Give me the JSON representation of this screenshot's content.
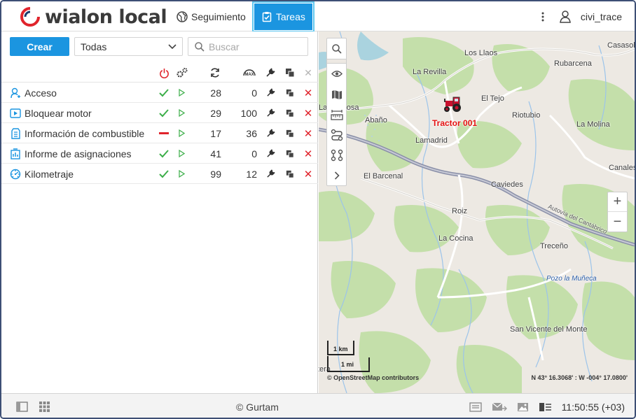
{
  "header": {
    "logo_text": "wialon local",
    "nav": [
      {
        "label": "Seguimiento",
        "icon": "globe-icon"
      },
      {
        "label": "Tareas",
        "icon": "clipboard-check-icon"
      }
    ],
    "user_name": "civi_trace"
  },
  "toolbar": {
    "create_label": "Crear",
    "filter_value": "Todas",
    "search_placeholder": "Buscar"
  },
  "table": {
    "columns": [
      "state",
      "run-settings",
      "count",
      "max",
      "edit",
      "copy",
      "delete"
    ],
    "rows": [
      {
        "icon": "user-key-icon",
        "name": "Acceso",
        "state": "enabled",
        "count": "28",
        "max": "0"
      },
      {
        "icon": "play-square-icon",
        "name": "Bloquear motor",
        "state": "enabled",
        "count": "29",
        "max": "100"
      },
      {
        "icon": "fuel-icon",
        "name": "Información de combustible",
        "state": "disabled",
        "count": "17",
        "max": "36"
      },
      {
        "icon": "building-report-icon",
        "name": "Informe de asignaciones",
        "state": "enabled",
        "count": "41",
        "max": "0"
      },
      {
        "icon": "odometer-icon",
        "name": "Kilometraje",
        "state": "enabled",
        "count": "99",
        "max": "12"
      }
    ]
  },
  "map": {
    "places": [
      {
        "name": "Casasola"
      },
      {
        "name": "Los Llaos"
      },
      {
        "name": "La Revilla"
      },
      {
        "name": "Rubarcena"
      },
      {
        "name": "El Tejo"
      },
      {
        "name": "La Acebosa"
      },
      {
        "name": "Abaño"
      },
      {
        "name": "Riotubio"
      },
      {
        "name": "La Molina"
      },
      {
        "name": "Lamadrid"
      },
      {
        "name": "Canales"
      },
      {
        "name": "El Barcenal"
      },
      {
        "name": "Caviedes"
      },
      {
        "name": "Roiz"
      },
      {
        "name": "La Cocina"
      },
      {
        "name": "Treceño"
      },
      {
        "name": "San Vicente del Monte"
      }
    ],
    "water_label": "Pozo la Muñeca",
    "road_label": "Autovía del Cantábrico",
    "unit_label": "Tractor 001",
    "scale_km": "1 km",
    "scale_mi": "1 mi",
    "attribution": "© OpenStreetMap contributors",
    "coordinates": "N 43° 16.3068' : W -004° 17.0800'",
    "edge_label": "tera",
    "zoom_in": "+",
    "zoom_out": "−"
  },
  "footer": {
    "copyright": "© Gurtam",
    "time": "11:50:55 (+03)"
  },
  "colors": {
    "accent": "#1b95e0",
    "ok": "#3cae49",
    "danger": "#e0242c",
    "frame": "#3d4f75"
  }
}
